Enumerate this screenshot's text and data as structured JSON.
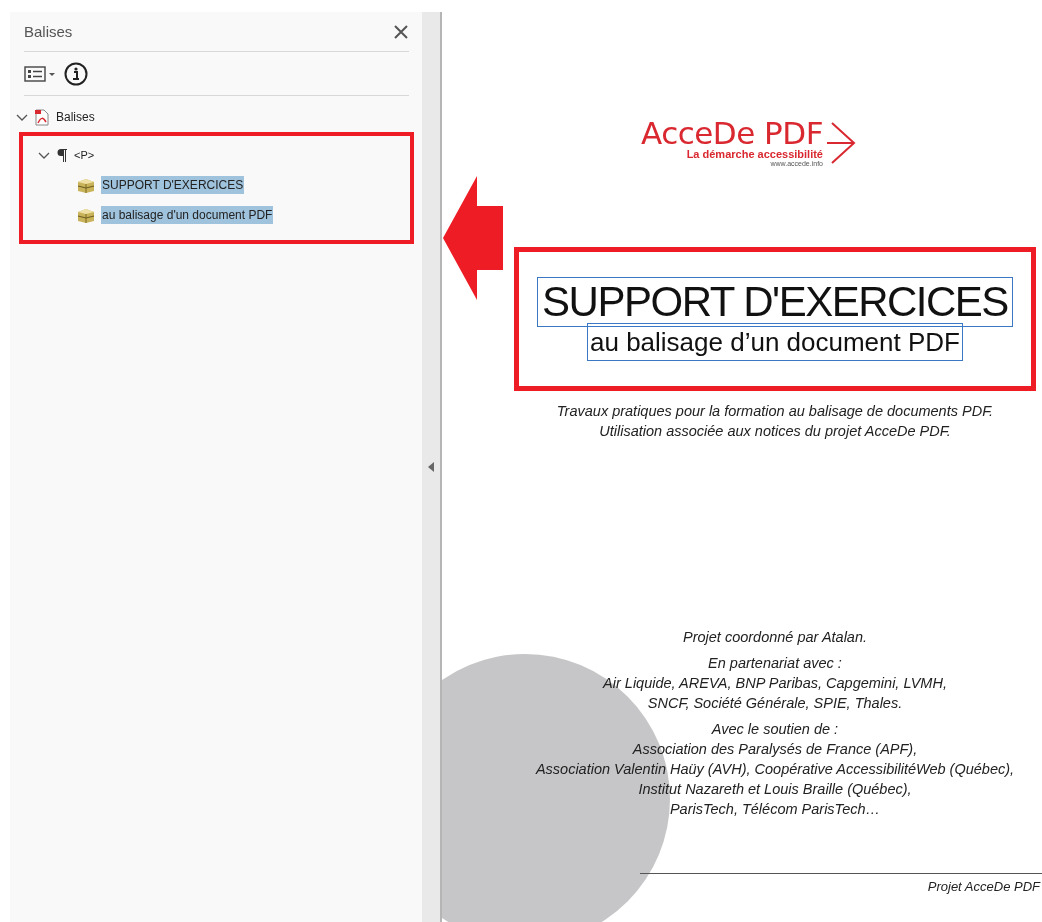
{
  "panel": {
    "title": "Balises",
    "framed": true,
    "tree": [
      {
        "label": "Balises",
        "kind": "root",
        "expanded": true,
        "selected": false,
        "children": [
          {
            "label": "<P>",
            "kind": "paragraph",
            "expanded": true,
            "selected": false,
            "children": [
              {
                "label": "SUPPORT D'EXERCICES",
                "kind": "content",
                "selected": true
              },
              {
                "label": "au balisage d'un document PDF",
                "kind": "content",
                "selected": true
              }
            ]
          }
        ]
      }
    ]
  },
  "pointer_arrow": true,
  "document": {
    "logo": {
      "name": "AcceDe PDF",
      "tagline": "La démarche accessibilité",
      "url": "www.accede.info"
    },
    "framed": true,
    "title": {
      "text": "SUPPORT D'EXERCICES",
      "outlined": true
    },
    "subtitle": {
      "text": "au balisage d’un document PDF",
      "outlined": true
    },
    "intro": [
      "Travaux pratiques pour la formation au balisage de documents PDF.",
      "Utilisation associée aux notices du projet AcceDe PDF."
    ],
    "credits": [
      [
        "Projet coordonné par Atalan."
      ],
      [
        "En partenariat avec :",
        "Air Liquide, AREVA, BNP Paribas, Capgemini, LVMH,",
        "SNCF, Société Générale, SPIE, Thales."
      ],
      [
        "Avec le soutien de :",
        "Association des Paralysés de France (APF),",
        "Association Valentin Haüy (AVH), Coopérative AccessibilitéWeb (Québec),",
        "Institut Nazareth et Louis Braille (Québec),",
        "ParisTech, Télécom ParisTech…"
      ]
    ],
    "footer": "Projet AcceDe PDF"
  }
}
